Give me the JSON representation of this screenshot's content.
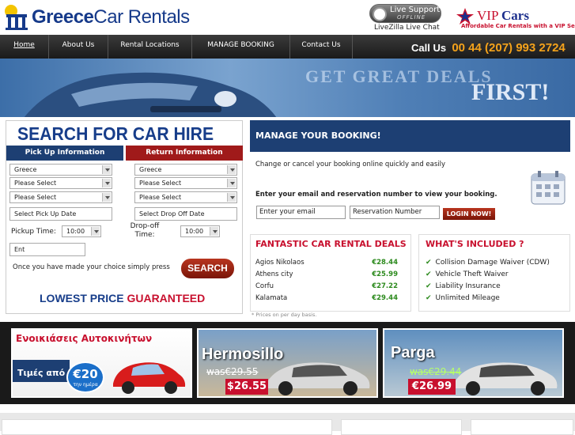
{
  "header": {
    "logo_brand": "Greece",
    "logo_rest": "Car Rentals",
    "live_support": "Live Support",
    "live_status": "OFFLINE",
    "livezilla": "LiveZilla Live Chat",
    "vip_brand_1": "VIP ",
    "vip_brand_2": "Cars",
    "vip_tagline": "Affordable Car Rentals with a VIP Service"
  },
  "nav": {
    "items": [
      {
        "label": "Home"
      },
      {
        "label": "About Us"
      },
      {
        "label": "Rental Locations"
      },
      {
        "label": "MANAGE BOOKING"
      },
      {
        "label": "Contact Us"
      }
    ],
    "call_label": "Call Us",
    "call_number": "00 44 (207) 993 2724"
  },
  "banner": {
    "line1": "GET GREAT DEALS",
    "line2": "FIRST!"
  },
  "search": {
    "title": "SEARCH FOR CAR HIRE",
    "pickup_tab": "Pick Up Information",
    "return_tab": "Return Information",
    "pickup_country": "Greece",
    "pickup_select1": "Please Select",
    "pickup_select2": "Please Select",
    "pickup_date_placeholder": "Select Pick Up Date",
    "pickup_time_label": "Pickup Time:",
    "pickup_time": "10:00",
    "return_country": "Greece",
    "return_select1": "Please Select",
    "return_select2": "Please Select",
    "dropoff_date_placeholder": "Select Drop Off Date",
    "dropoff_time_label": "Drop-off Time:",
    "dropoff_time": "10:00",
    "extra_field": "Ent",
    "hint": "Once you have made your choice simply press",
    "button": "SEARCH",
    "lowest_1": "LOWEST PRICE ",
    "lowest_2": "GUARANTEED"
  },
  "manage": {
    "title": "MANAGE YOUR BOOKING!",
    "text": "Change or cancel your booking online quickly and easily",
    "prompt": "Enter your email and reservation number to view your booking.",
    "email_placeholder": "Enter your email",
    "reservation_placeholder": "Reservation Number",
    "login": "LOGIN NOW!"
  },
  "deals": {
    "title": "FANTASTIC CAR RENTAL DEALS",
    "rows": [
      {
        "city": "Agios Nikolaos",
        "price": "€28.44"
      },
      {
        "city": "Athens city",
        "price": "€25.99"
      },
      {
        "city": "Corfu",
        "price": "€27.22"
      },
      {
        "city": "Kalamata",
        "price": "€29.44"
      }
    ],
    "footnote": "* Prices on per day basis."
  },
  "included": {
    "title": "WHAT'S INCLUDED ?",
    "items": [
      "Collision Damage Waiver (CDW)",
      "Vehicle Theft Waiver",
      "Liability Insurance",
      "Unlimited Mileage"
    ]
  },
  "promos": {
    "p1_title": "Ενοικιάσεις Αυτοκινήτων",
    "p1_from": "Τιμές από",
    "p1_price": "€20",
    "p1_per": "την ημέρα",
    "p2_title": "Hermosillo",
    "p2_was": "was€29.55",
    "p2_price": "$26.55",
    "p3_title": "Parga",
    "p3_was": "was€29.44",
    "p3_price": "€26.99"
  },
  "colors": {
    "brand_blue": "#173d8a",
    "accent_red": "#c8102e",
    "price_green": "#2c8a1d",
    "nav_dark": "#1a1a1a",
    "call_orange": "#f4a21b"
  }
}
